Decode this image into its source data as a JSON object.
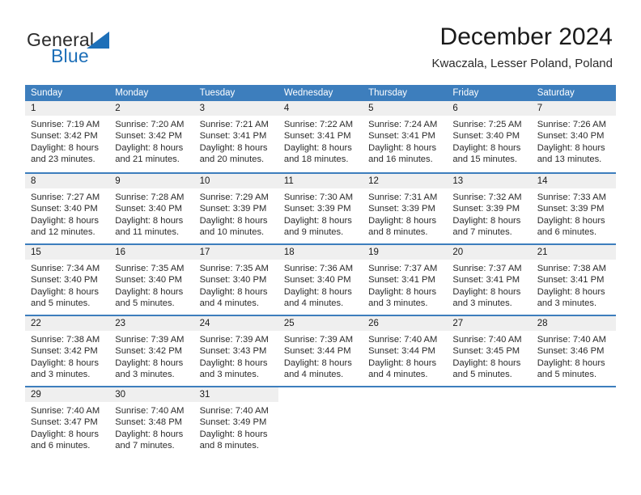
{
  "brand": {
    "word1": "General",
    "word2": "Blue",
    "mark": "triangle-logo-icon"
  },
  "header": {
    "title": "December 2024",
    "location": "Kwaczala, Lesser Poland, Poland"
  },
  "theme": {
    "header_blue": "#3d7ebd",
    "daynum_band": "#efefef",
    "brand_blue": "#1d6fb8",
    "text": "#2b2b2b"
  },
  "weekdays": [
    "Sunday",
    "Monday",
    "Tuesday",
    "Wednesday",
    "Thursday",
    "Friday",
    "Saturday"
  ],
  "weeks": [
    [
      {
        "day": "1",
        "lines": [
          "Sunrise: 7:19 AM",
          "Sunset: 3:42 PM",
          "Daylight: 8 hours",
          "and 23 minutes."
        ]
      },
      {
        "day": "2",
        "lines": [
          "Sunrise: 7:20 AM",
          "Sunset: 3:42 PM",
          "Daylight: 8 hours",
          "and 21 minutes."
        ]
      },
      {
        "day": "3",
        "lines": [
          "Sunrise: 7:21 AM",
          "Sunset: 3:41 PM",
          "Daylight: 8 hours",
          "and 20 minutes."
        ]
      },
      {
        "day": "4",
        "lines": [
          "Sunrise: 7:22 AM",
          "Sunset: 3:41 PM",
          "Daylight: 8 hours",
          "and 18 minutes."
        ]
      },
      {
        "day": "5",
        "lines": [
          "Sunrise: 7:24 AM",
          "Sunset: 3:41 PM",
          "Daylight: 8 hours",
          "and 16 minutes."
        ]
      },
      {
        "day": "6",
        "lines": [
          "Sunrise: 7:25 AM",
          "Sunset: 3:40 PM",
          "Daylight: 8 hours",
          "and 15 minutes."
        ]
      },
      {
        "day": "7",
        "lines": [
          "Sunrise: 7:26 AM",
          "Sunset: 3:40 PM",
          "Daylight: 8 hours",
          "and 13 minutes."
        ]
      }
    ],
    [
      {
        "day": "8",
        "lines": [
          "Sunrise: 7:27 AM",
          "Sunset: 3:40 PM",
          "Daylight: 8 hours",
          "and 12 minutes."
        ]
      },
      {
        "day": "9",
        "lines": [
          "Sunrise: 7:28 AM",
          "Sunset: 3:40 PM",
          "Daylight: 8 hours",
          "and 11 minutes."
        ]
      },
      {
        "day": "10",
        "lines": [
          "Sunrise: 7:29 AM",
          "Sunset: 3:39 PM",
          "Daylight: 8 hours",
          "and 10 minutes."
        ]
      },
      {
        "day": "11",
        "lines": [
          "Sunrise: 7:30 AM",
          "Sunset: 3:39 PM",
          "Daylight: 8 hours",
          "and 9 minutes."
        ]
      },
      {
        "day": "12",
        "lines": [
          "Sunrise: 7:31 AM",
          "Sunset: 3:39 PM",
          "Daylight: 8 hours",
          "and 8 minutes."
        ]
      },
      {
        "day": "13",
        "lines": [
          "Sunrise: 7:32 AM",
          "Sunset: 3:39 PM",
          "Daylight: 8 hours",
          "and 7 minutes."
        ]
      },
      {
        "day": "14",
        "lines": [
          "Sunrise: 7:33 AM",
          "Sunset: 3:39 PM",
          "Daylight: 8 hours",
          "and 6 minutes."
        ]
      }
    ],
    [
      {
        "day": "15",
        "lines": [
          "Sunrise: 7:34 AM",
          "Sunset: 3:40 PM",
          "Daylight: 8 hours",
          "and 5 minutes."
        ]
      },
      {
        "day": "16",
        "lines": [
          "Sunrise: 7:35 AM",
          "Sunset: 3:40 PM",
          "Daylight: 8 hours",
          "and 5 minutes."
        ]
      },
      {
        "day": "17",
        "lines": [
          "Sunrise: 7:35 AM",
          "Sunset: 3:40 PM",
          "Daylight: 8 hours",
          "and 4 minutes."
        ]
      },
      {
        "day": "18",
        "lines": [
          "Sunrise: 7:36 AM",
          "Sunset: 3:40 PM",
          "Daylight: 8 hours",
          "and 4 minutes."
        ]
      },
      {
        "day": "19",
        "lines": [
          "Sunrise: 7:37 AM",
          "Sunset: 3:41 PM",
          "Daylight: 8 hours",
          "and 3 minutes."
        ]
      },
      {
        "day": "20",
        "lines": [
          "Sunrise: 7:37 AM",
          "Sunset: 3:41 PM",
          "Daylight: 8 hours",
          "and 3 minutes."
        ]
      },
      {
        "day": "21",
        "lines": [
          "Sunrise: 7:38 AM",
          "Sunset: 3:41 PM",
          "Daylight: 8 hours",
          "and 3 minutes."
        ]
      }
    ],
    [
      {
        "day": "22",
        "lines": [
          "Sunrise: 7:38 AM",
          "Sunset: 3:42 PM",
          "Daylight: 8 hours",
          "and 3 minutes."
        ]
      },
      {
        "day": "23",
        "lines": [
          "Sunrise: 7:39 AM",
          "Sunset: 3:42 PM",
          "Daylight: 8 hours",
          "and 3 minutes."
        ]
      },
      {
        "day": "24",
        "lines": [
          "Sunrise: 7:39 AM",
          "Sunset: 3:43 PM",
          "Daylight: 8 hours",
          "and 3 minutes."
        ]
      },
      {
        "day": "25",
        "lines": [
          "Sunrise: 7:39 AM",
          "Sunset: 3:44 PM",
          "Daylight: 8 hours",
          "and 4 minutes."
        ]
      },
      {
        "day": "26",
        "lines": [
          "Sunrise: 7:40 AM",
          "Sunset: 3:44 PM",
          "Daylight: 8 hours",
          "and 4 minutes."
        ]
      },
      {
        "day": "27",
        "lines": [
          "Sunrise: 7:40 AM",
          "Sunset: 3:45 PM",
          "Daylight: 8 hours",
          "and 5 minutes."
        ]
      },
      {
        "day": "28",
        "lines": [
          "Sunrise: 7:40 AM",
          "Sunset: 3:46 PM",
          "Daylight: 8 hours",
          "and 5 minutes."
        ]
      }
    ],
    [
      {
        "day": "29",
        "lines": [
          "Sunrise: 7:40 AM",
          "Sunset: 3:47 PM",
          "Daylight: 8 hours",
          "and 6 minutes."
        ]
      },
      {
        "day": "30",
        "lines": [
          "Sunrise: 7:40 AM",
          "Sunset: 3:48 PM",
          "Daylight: 8 hours",
          "and 7 minutes."
        ]
      },
      {
        "day": "31",
        "lines": [
          "Sunrise: 7:40 AM",
          "Sunset: 3:49 PM",
          "Daylight: 8 hours",
          "and 8 minutes."
        ]
      },
      {
        "day": "",
        "lines": []
      },
      {
        "day": "",
        "lines": []
      },
      {
        "day": "",
        "lines": []
      },
      {
        "day": "",
        "lines": []
      }
    ]
  ]
}
